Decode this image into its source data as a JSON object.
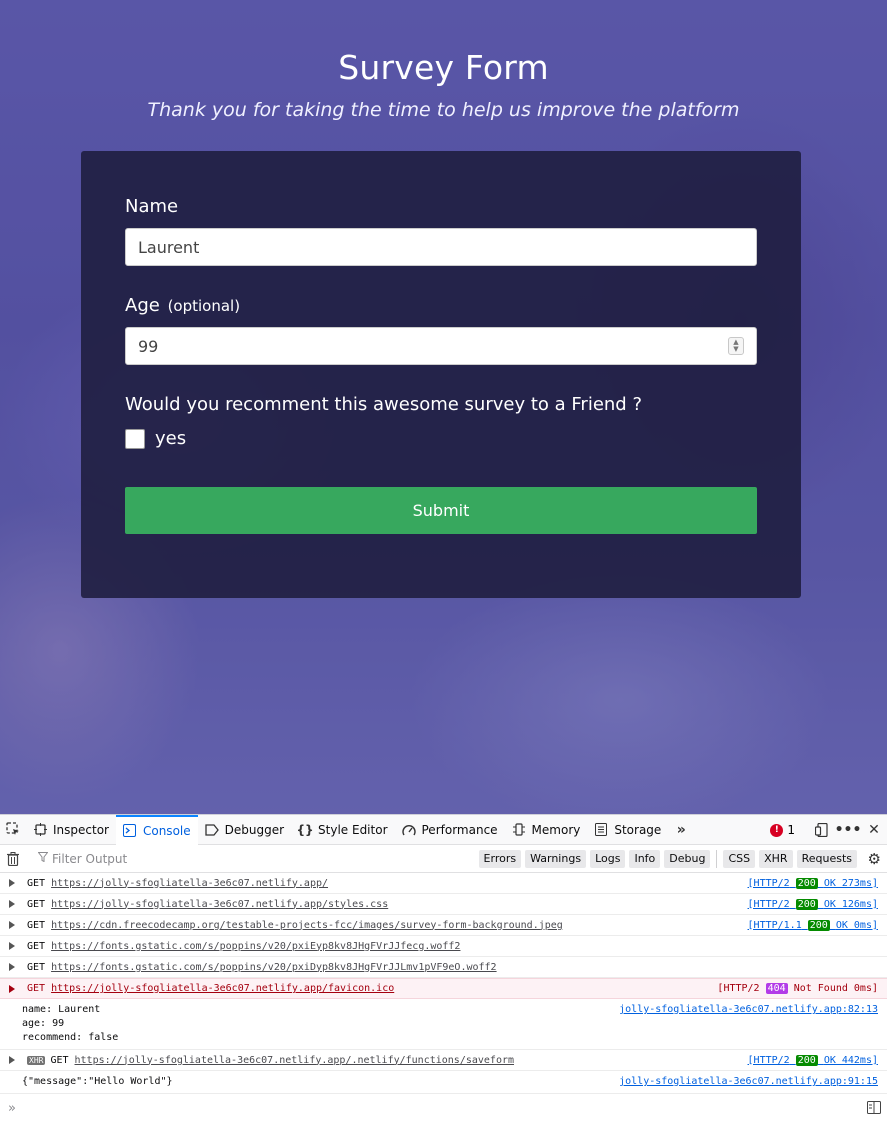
{
  "page": {
    "title": "Survey Form",
    "subtitle": "Thank you for taking the time to help us improve the platform"
  },
  "form": {
    "name_label": "Name",
    "name_value": "Laurent",
    "age_label": "Age",
    "age_optional": "(optional)",
    "age_value": "99",
    "question": "Would you recomment this awesome survey to a Friend ?",
    "checkbox_label": "yes",
    "checkbox_checked": false,
    "submit_label": "Submit",
    "accent_color": "#37a85e"
  },
  "devtools": {
    "tabs": [
      {
        "label": "Inspector",
        "icon": "inspector-icon"
      },
      {
        "label": "Console",
        "icon": "console-icon",
        "active": true
      },
      {
        "label": "Debugger",
        "icon": "debugger-icon"
      },
      {
        "label": "Style Editor",
        "icon": "style-editor-icon"
      },
      {
        "label": "Performance",
        "icon": "performance-icon"
      },
      {
        "label": "Memory",
        "icon": "memory-icon"
      },
      {
        "label": "Storage",
        "icon": "storage-icon"
      }
    ],
    "error_count": "1",
    "error_glyph": "!",
    "filter_placeholder": "Filter Output",
    "filter_buttons": [
      "Errors",
      "Warnings",
      "Logs",
      "Info",
      "Debug",
      "CSS",
      "XHR",
      "Requests"
    ],
    "logs": [
      {
        "method": "GET",
        "url": "https://jolly-sfogliatella-3e6c07.netlify.app/",
        "proto": "[HTTP/2",
        "code": "200",
        "rest": "OK 273ms]"
      },
      {
        "method": "GET",
        "url": "https://jolly-sfogliatella-3e6c07.netlify.app/styles.css",
        "proto": "[HTTP/2",
        "code": "200",
        "rest": "OK 126ms]"
      },
      {
        "method": "GET",
        "url": "https://cdn.freecodecamp.org/testable-projects-fcc/images/survey-form-background.jpeg",
        "proto": "[HTTP/1.1",
        "code": "200",
        "rest": "OK 0ms]"
      },
      {
        "method": "GET",
        "url": "https://fonts.gstatic.com/s/poppins/v20/pxiEyp8kv8JHgFVrJJfecg.woff2"
      },
      {
        "method": "GET",
        "url": "https://fonts.gstatic.com/s/poppins/v20/pxiDyp8kv8JHgFVrJJLmv1pVF9eO.woff2"
      },
      {
        "method": "GET",
        "url": "https://jolly-sfogliatella-3e6c07.netlify.app/favicon.ico",
        "proto": "[HTTP/2",
        "code": "404",
        "rest": "Not Found 0ms]",
        "error": true
      }
    ],
    "message1": {
      "lines": [
        "name: Laurent",
        "age: 99",
        "recommend: false"
      ],
      "source": "jolly-sfogliatella-3e6c07.netlify.app:82:13"
    },
    "xhr_log": {
      "tag": "XHR",
      "method": "GET",
      "url": "https://jolly-sfogliatella-3e6c07.netlify.app/.netlify/functions/saveform",
      "proto": "[HTTP/2",
      "code": "200",
      "rest": "OK 442ms]"
    },
    "message2": {
      "text": "{\"message\":\"Hello World\"}",
      "source": "jolly-sfogliatella-3e6c07.netlify.app:91:15"
    }
  }
}
